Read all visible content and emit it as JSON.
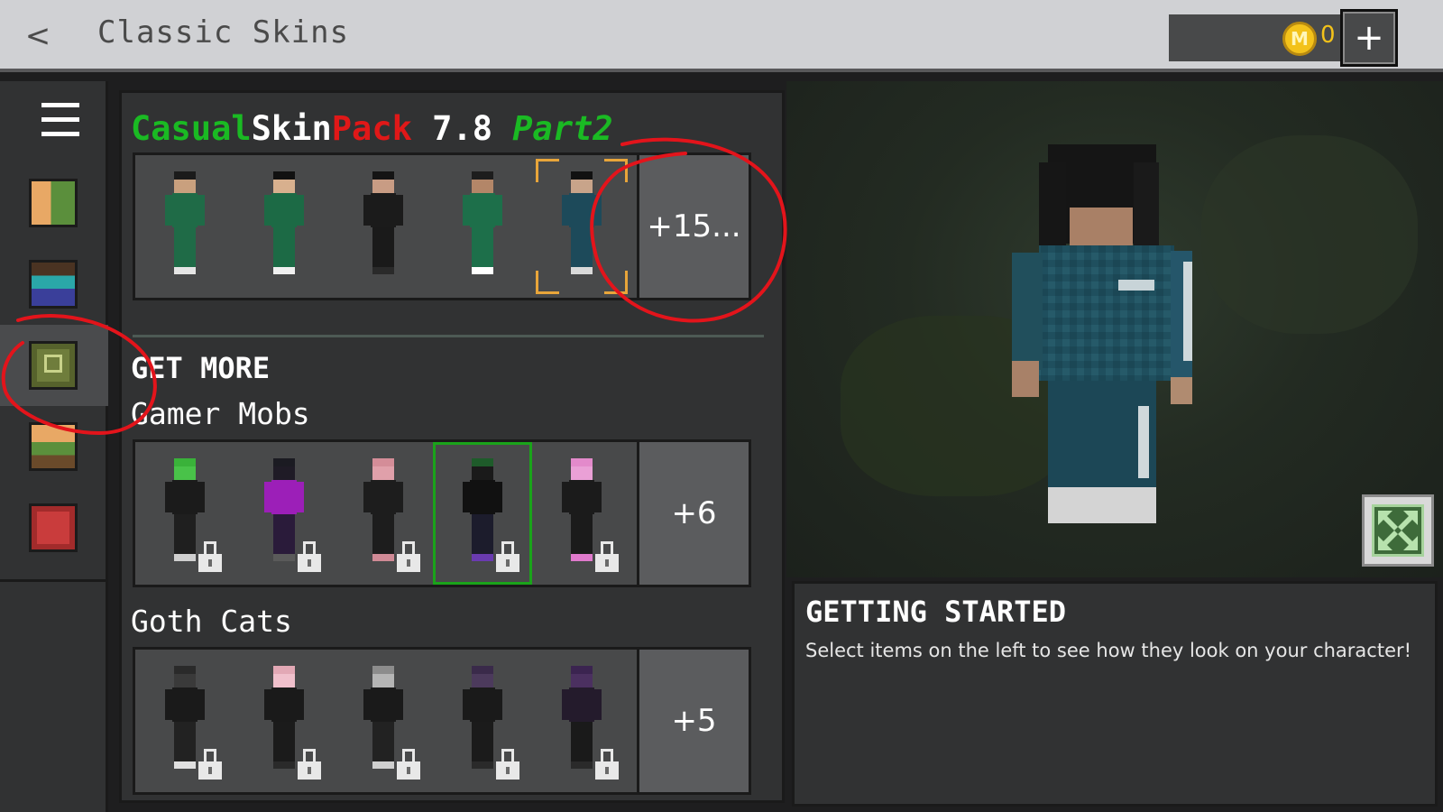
{
  "header": {
    "back_glyph": "<",
    "title": "Classic Skins",
    "coins": "0",
    "coin_glyph": "M",
    "add_glyph": "+"
  },
  "rail": {
    "items": [
      {
        "name": "menu-icon"
      },
      {
        "name": "character-creator-icon"
      },
      {
        "name": "character-icon"
      },
      {
        "name": "skin-pack-icon",
        "selected": true
      },
      {
        "name": "classic-character-icon"
      },
      {
        "name": "store-icon"
      }
    ]
  },
  "owned_pack": {
    "title_parts": [
      "Casual",
      "Skin",
      "P",
      "ack",
      " 7.8 ",
      "Part2"
    ],
    "more_label": "+15...",
    "skins": [
      {
        "hair": "#1b1b1b",
        "skin": "#c9a07e",
        "shirt": "#1f6b47",
        "legs": "#1f6b47",
        "feet": "#e5e5e5"
      },
      {
        "hair": "#111111",
        "skin": "#d8b08e",
        "shirt": "#1c6a45",
        "legs": "#1c6a45",
        "feet": "#f0f0f0"
      },
      {
        "hair": "#141414",
        "skin": "#c89c84",
        "shirt": "#1b1b1b",
        "legs": "#1a1a1a",
        "feet": "#2a2a2a"
      },
      {
        "hair": "#1d1d1d",
        "skin": "#b38668",
        "shirt": "#1d6f4a",
        "legs": "#1d6f4a",
        "feet": "#ffffff"
      },
      {
        "hair": "#111111",
        "skin": "#c8a48a",
        "shirt": "#1d4a5a",
        "legs": "#1d4a5a",
        "feet": "#d9d9d9"
      }
    ]
  },
  "get_more_label": "GET MORE",
  "packs": [
    {
      "title": "Gamer Mobs",
      "more_label": "+6",
      "skins": [
        {
          "hair": "#3ab23a",
          "skin": "#49c249",
          "shirt": "#1b1b1b",
          "legs": "#1f1f1f",
          "feet": "#cfcfcf",
          "highlight": false
        },
        {
          "hair": "#1b1b22",
          "skin": "#1f1b26",
          "shirt": "#9c1fb8",
          "legs": "#2a1b3a",
          "feet": "#5a5a5a",
          "highlight": false
        },
        {
          "hair": "#d48d98",
          "skin": "#e0a0aa",
          "shirt": "#1d1d1d",
          "legs": "#1d1d1d",
          "feet": "#d08a96",
          "highlight": false
        },
        {
          "hair": "#1e5b2a",
          "skin": "#1a1a1a",
          "shirt": "#111111",
          "legs": "#1c1c2c",
          "feet": "#6a3bb0",
          "highlight": true
        },
        {
          "hair": "#e38acb",
          "skin": "#eaa0d6",
          "shirt": "#1b1b1b",
          "legs": "#1b1b1b",
          "feet": "#e07acc",
          "highlight": false
        }
      ]
    },
    {
      "title": "Goth Cats",
      "more_label": "+5",
      "skins": [
        {
          "hair": "#2a2a2a",
          "skin": "#3a3a3a",
          "shirt": "#1a1a1a",
          "legs": "#222",
          "feet": "#e0e0e0",
          "highlight": false
        },
        {
          "hair": "#e2a8b5",
          "skin": "#f0c0cc",
          "shirt": "#1a1a1a",
          "legs": "#1b1b1b",
          "feet": "#2a2a2a",
          "highlight": false
        },
        {
          "hair": "#8c8c8c",
          "skin": "#b5b5b5",
          "shirt": "#1a1a1a",
          "legs": "#222",
          "feet": "#cfcfcf",
          "highlight": false
        },
        {
          "hair": "#3a2a4a",
          "skin": "#4c3a5c",
          "shirt": "#1a1a1a",
          "legs": "#1b1b1b",
          "feet": "#2a2a2a",
          "highlight": false
        },
        {
          "hair": "#3b2450",
          "skin": "#4b3060",
          "shirt": "#241b2c",
          "legs": "#1a1a1a",
          "feet": "#2a2a2a",
          "highlight": false
        }
      ]
    }
  ],
  "info": {
    "title": "GETTING STARTED",
    "text": "Select items on the left to see how they look on your character!"
  },
  "colors": {
    "pack_green": "#1aba23",
    "pack_red": "#e01818",
    "annotation": "#e3141b",
    "coin": "#f3c21a"
  }
}
